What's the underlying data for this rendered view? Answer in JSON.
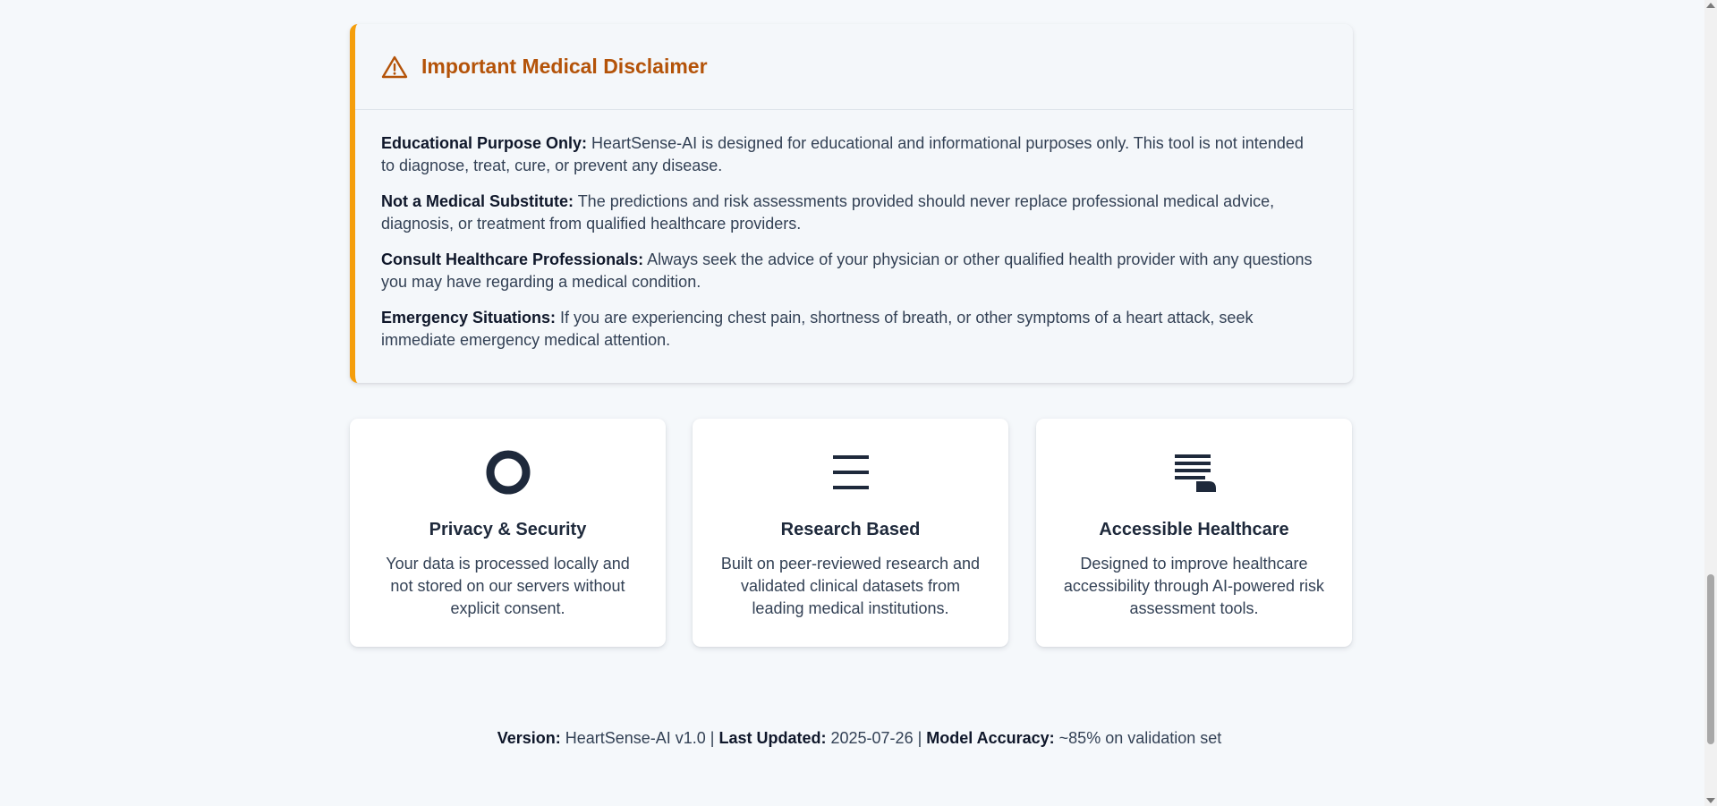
{
  "disclaimer": {
    "title": "Important Medical Disclaimer",
    "icon": "warning-triangle-icon",
    "accent_color": "#f59e0b",
    "title_color": "#b45309",
    "items": [
      {
        "label": "Educational Purpose Only:",
        "text": " HeartSense-AI is designed for educational and informational purposes only. This tool is not intended to diagnose, treat, cure, or prevent any disease."
      },
      {
        "label": "Not a Medical Substitute:",
        "text": " The predictions and risk assessments provided should never replace professional medical advice, diagnosis, or treatment from qualified healthcare providers."
      },
      {
        "label": "Consult Healthcare Professionals:",
        "text": " Always seek the advice of your physician or other qualified health provider with any questions you may have regarding a medical condition."
      },
      {
        "label": "Emergency Situations:",
        "text": " If you are experiencing chest pain, shortness of breath, or other symptoms of a heart attack, seek immediate emergency medical attention."
      }
    ]
  },
  "features": [
    {
      "icon": "circle-icon",
      "title": "Privacy & Security",
      "text": "Your data is processed locally and not stored on our servers without explicit consent."
    },
    {
      "icon": "menu-lines-icon",
      "title": "Research Based",
      "text": "Built on peer-reviewed research and validated clinical datasets from leading medical institutions."
    },
    {
      "icon": "document-lines-icon",
      "title": "Accessible Healthcare",
      "text": "Designed to improve healthcare accessibility through AI-powered risk assessment tools."
    }
  ],
  "footer": {
    "version_label": "Version:",
    "version_value": " HeartSense-AI v1.0 | ",
    "updated_label": "Last Updated:",
    "updated_value": " 2025-07-26 | ",
    "accuracy_label": "Model Accuracy:",
    "accuracy_value": " ~85% on validation set"
  }
}
